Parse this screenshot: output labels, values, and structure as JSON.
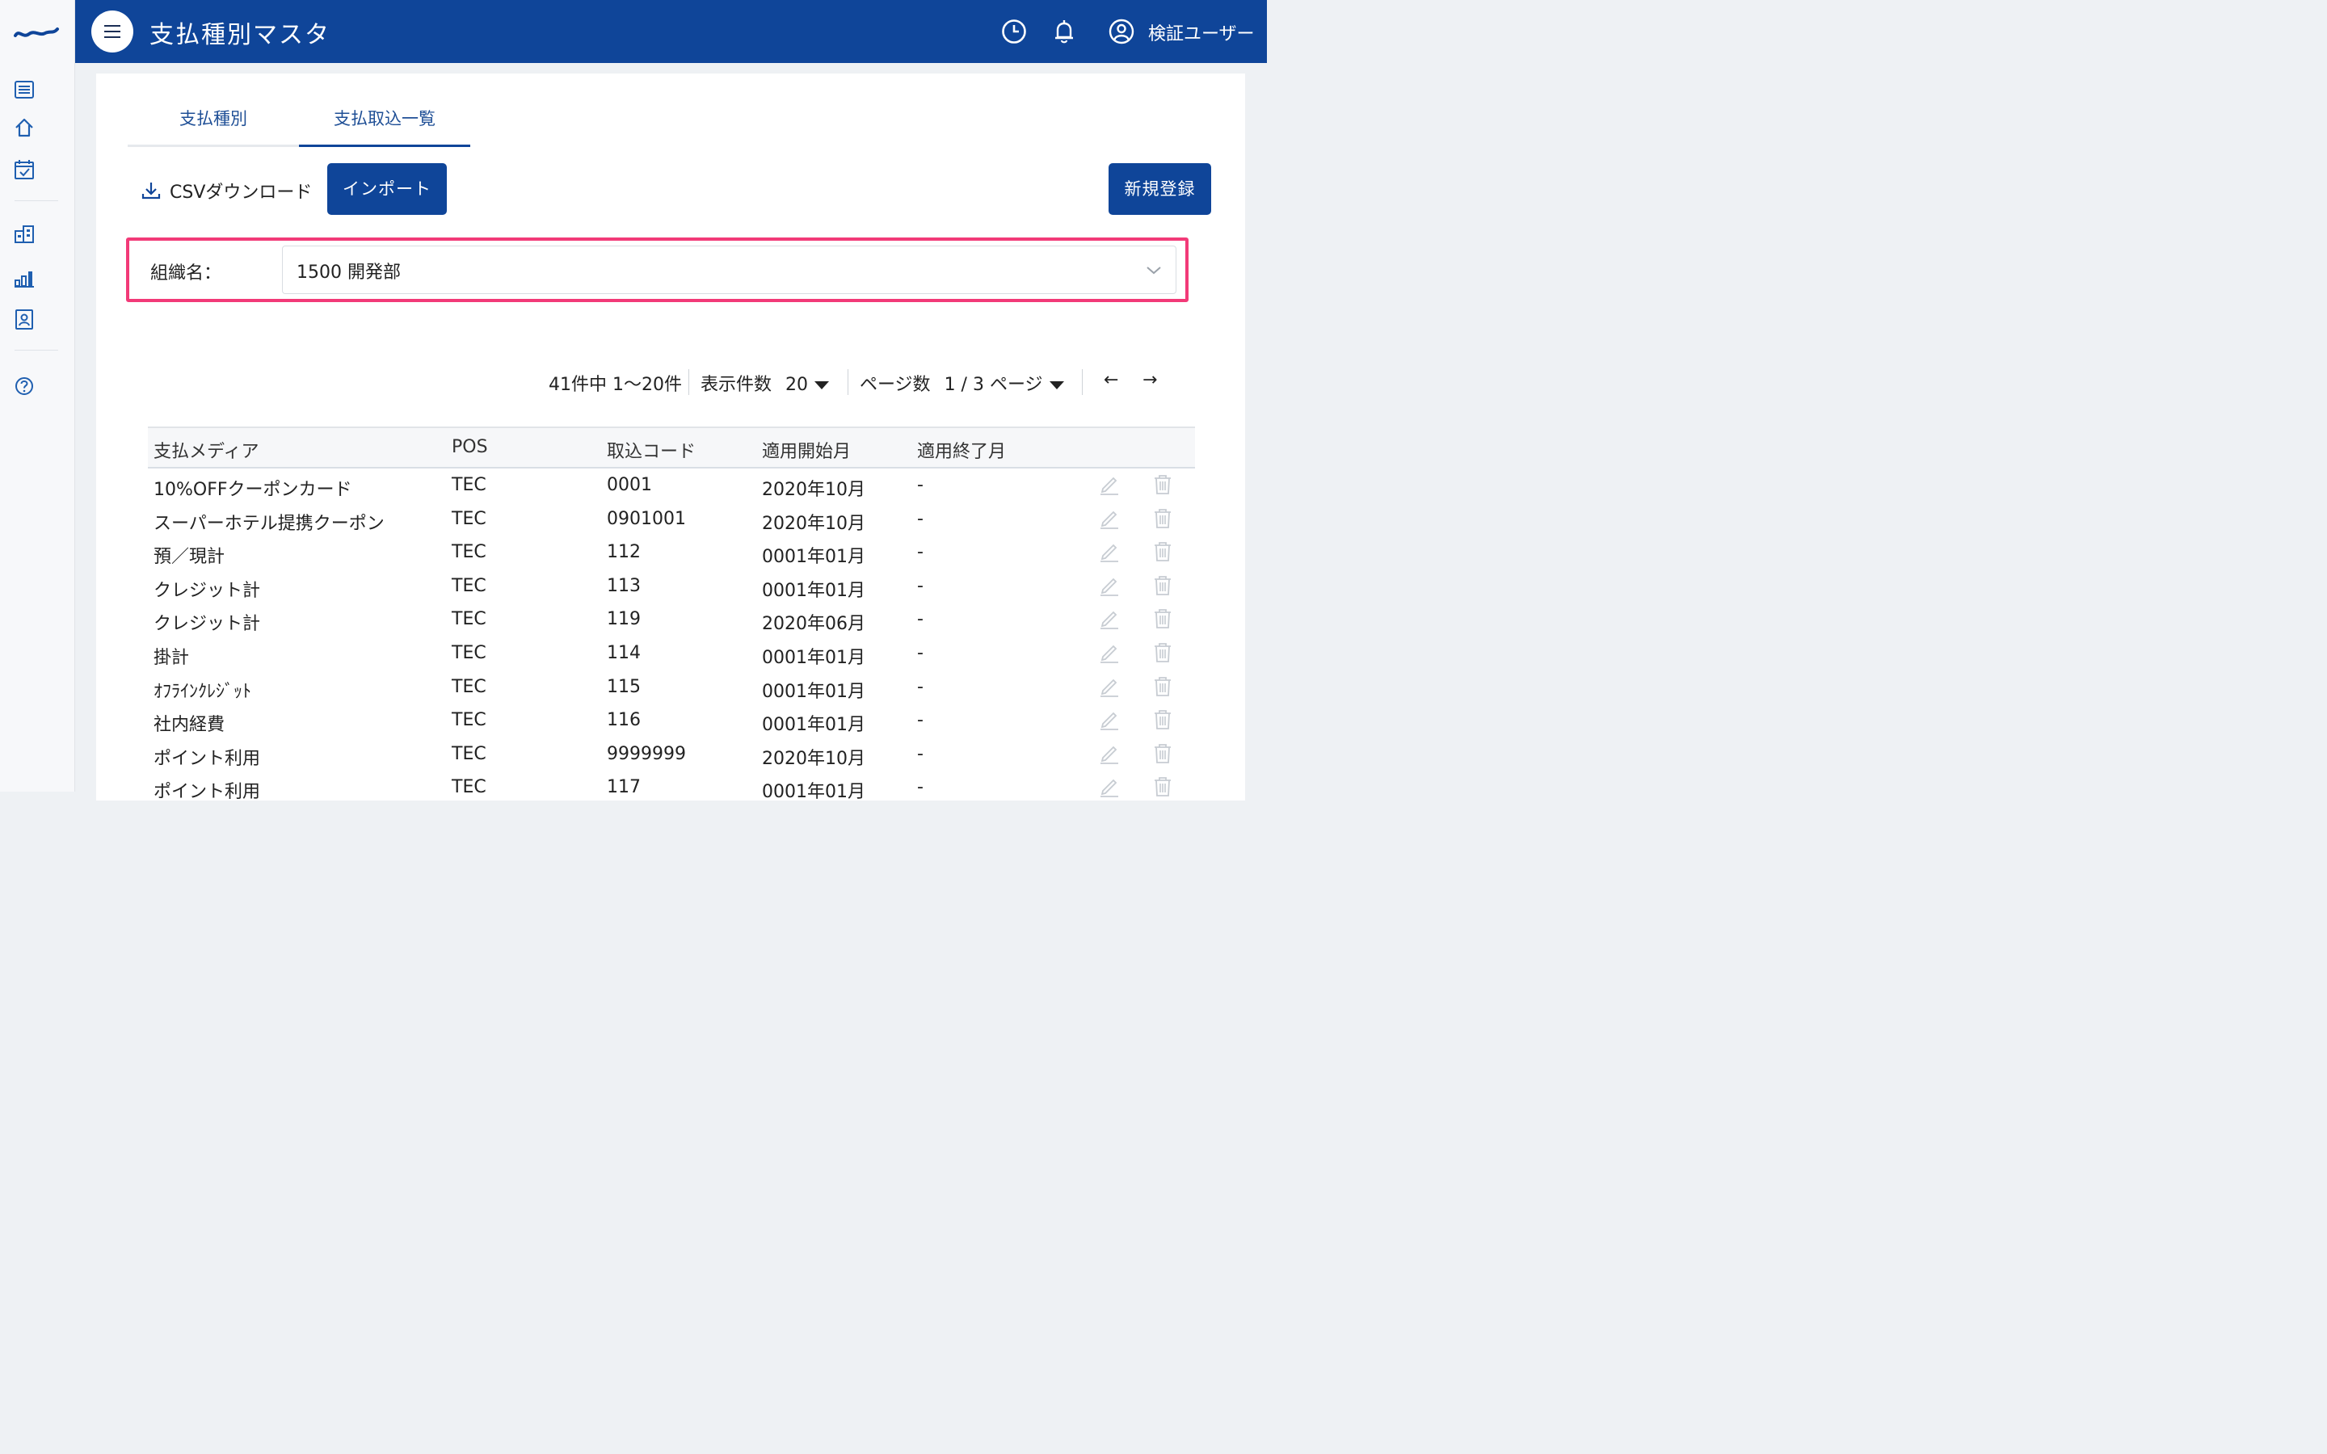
{
  "header": {
    "title": "支払種別マスタ",
    "user_name": "検証ユーザー"
  },
  "tabs": [
    {
      "label": "支払種別"
    },
    {
      "label": "支払取込一覧"
    }
  ],
  "toolbar": {
    "csv_label": "CSVダウンロード",
    "import_label": "インポート",
    "new_label": "新規登録"
  },
  "filter": {
    "label": "組織名：",
    "value": "1500 開発部"
  },
  "pager": {
    "range_text": "41件中 1〜20件",
    "per_page_label": "表示件数",
    "per_page_value": "20",
    "page_label": "ページ数",
    "page_value": "1 / 3 ページ",
    "prev": "←",
    "next": "→"
  },
  "table": {
    "headers": [
      "支払メディア",
      "POS",
      "取込コード",
      "適用開始月",
      "適用終了月"
    ],
    "rows": [
      {
        "media": "10%OFFクーポンカード",
        "pos": "TEC",
        "code": "0001",
        "start": "2020年10月",
        "end": "-"
      },
      {
        "media": "スーパーホテル提携クーポン",
        "pos": "TEC",
        "code": "0901001",
        "start": "2020年10月",
        "end": "-"
      },
      {
        "media": "預／現計",
        "pos": "TEC",
        "code": "112",
        "start": "0001年01月",
        "end": "-"
      },
      {
        "media": "クレジット計",
        "pos": "TEC",
        "code": "113",
        "start": "0001年01月",
        "end": "-"
      },
      {
        "media": "クレジット計",
        "pos": "TEC",
        "code": "119",
        "start": "2020年06月",
        "end": "-"
      },
      {
        "media": "掛計",
        "pos": "TEC",
        "code": "114",
        "start": "0001年01月",
        "end": "-"
      },
      {
        "media": "ｵﾌﾗｲﾝｸﾚｼﾞｯﾄ",
        "pos": "TEC",
        "code": "115",
        "start": "0001年01月",
        "end": "-"
      },
      {
        "media": "社内経費",
        "pos": "TEC",
        "code": "116",
        "start": "0001年01月",
        "end": "-"
      },
      {
        "media": "ポイント利用",
        "pos": "TEC",
        "code": "9999999",
        "start": "2020年10月",
        "end": "-"
      },
      {
        "media": "ポイント利用",
        "pos": "TEC",
        "code": "117",
        "start": "0001年01月",
        "end": "-"
      }
    ]
  },
  "colors": {
    "brand": "#0f4599",
    "highlight": "#f23a78",
    "sidebar_icon": "#1f5fb0"
  }
}
